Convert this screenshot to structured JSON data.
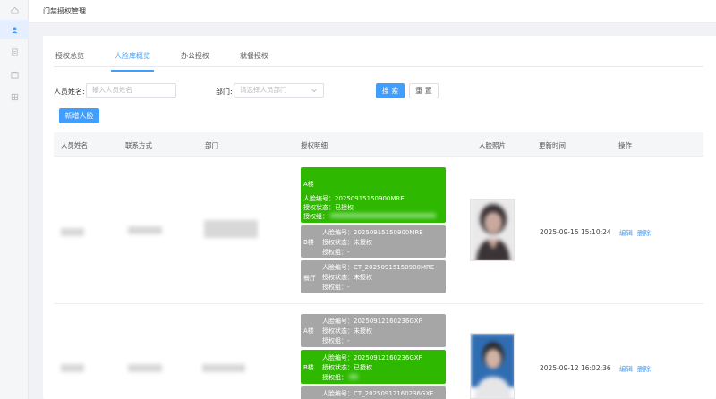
{
  "app": {
    "title": "门禁授权管理"
  },
  "sidebar": {
    "items": [
      {
        "icon": "home-icon"
      },
      {
        "icon": "user-icon",
        "active": true
      },
      {
        "icon": "document-icon"
      },
      {
        "icon": "briefcase-icon"
      },
      {
        "icon": "grid-icon"
      }
    ]
  },
  "tabs": [
    {
      "label": "授权总览"
    },
    {
      "label": "人脸库概览",
      "active": true
    },
    {
      "label": "办公授权"
    },
    {
      "label": "就餐授权"
    }
  ],
  "filters": {
    "name_label": "人员姓名:",
    "name_placeholder": "输入人员姓名",
    "dept_label": "部门:",
    "dept_placeholder": "请选择人员部门",
    "search_button": "搜 索",
    "reset_button": "重 置",
    "add_button": "新增人脸"
  },
  "table": {
    "headers": [
      "人员姓名",
      "联系方式",
      "部门",
      "授权明细",
      "人脸照片",
      "更新时间",
      "操作"
    ],
    "rows": [
      {
        "updated": "2025-09-15 15:10:24",
        "actions": [
          "编辑",
          "删除"
        ],
        "auths": [
          {
            "building": "A楼",
            "status_color": "green",
            "face_no": "人脸编号：20250915150900MRE",
            "state": "授权状态：已授权",
            "group": "授权组："
          },
          {
            "building": "B楼",
            "status_color": "gray",
            "face_no": "人脸编号：20250915150900MRE",
            "state": "授权状态：未授权",
            "group": "授权组：-"
          },
          {
            "building": "餐厅",
            "status_color": "gray",
            "face_no": "人脸编号：CT_20250915150900MRE",
            "state": "授权状态：未授权",
            "group": "授权组：-"
          }
        ]
      },
      {
        "updated": "2025-09-12 16:02:36",
        "actions": [
          "编辑",
          "删除"
        ],
        "auths": [
          {
            "building": "A楼",
            "status_color": "gray",
            "face_no": "人脸编号：20250912160236GXF",
            "state": "授权状态：未授权",
            "group": "授权组：-"
          },
          {
            "building": "B楼",
            "status_color": "green",
            "face_no": "人脸编号：20250912160236GXF",
            "state": "授权状态：已授权",
            "group": "授权组："
          },
          {
            "building": "",
            "status_color": "gray",
            "face_no": "人脸编号：CT_20250912160236GXF",
            "state": "",
            "group": ""
          }
        ]
      }
    ]
  },
  "colors": {
    "primary": "#409eff",
    "authorized": "#2fb800",
    "unauthorized": "#a6a6a6"
  }
}
